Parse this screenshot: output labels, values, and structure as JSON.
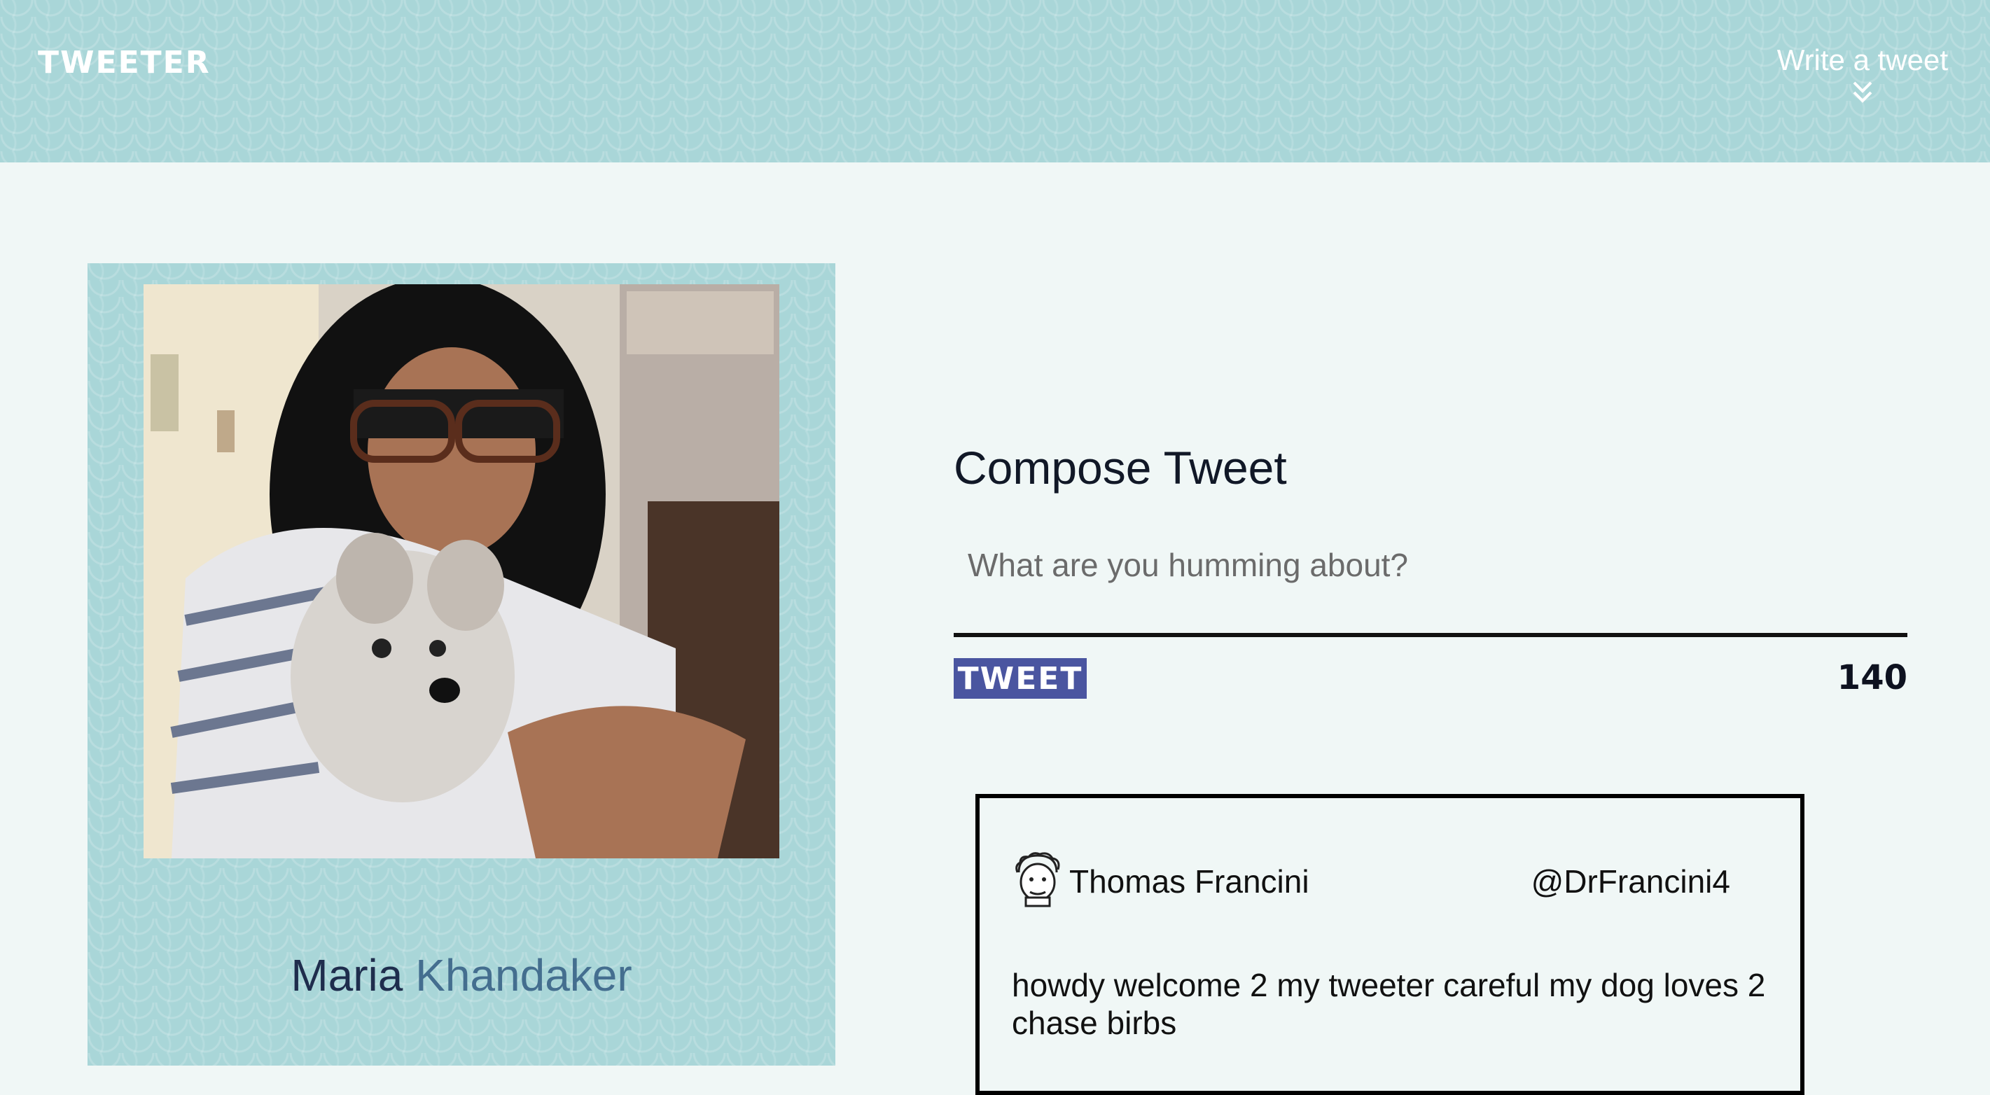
{
  "nav": {
    "brand": "TWEETER",
    "write_link": "Write a tweet",
    "write_icon": "double-chevron-down-icon"
  },
  "profile": {
    "first_name": "Maria",
    "last_name": "Khandaker",
    "photo": "user-photo"
  },
  "compose": {
    "title": "Compose Tweet",
    "placeholder": "What are you humming about?",
    "value": "",
    "button_label": "TWEET",
    "counter": "140"
  },
  "tweets": [
    {
      "avatar": "cartoon-face-avatar-icon",
      "name": "Thomas Francini",
      "handle": "@DrFrancini4",
      "text": "howdy welcome 2 my tweeter careful my dog loves 2 chase birbs"
    }
  ],
  "colors": {
    "header_bg": "#a9d6d8",
    "page_bg": "#f0f7f6",
    "button_bg": "#4a55a0",
    "name_first": "#1f2d4d",
    "name_last": "#446e8f"
  }
}
